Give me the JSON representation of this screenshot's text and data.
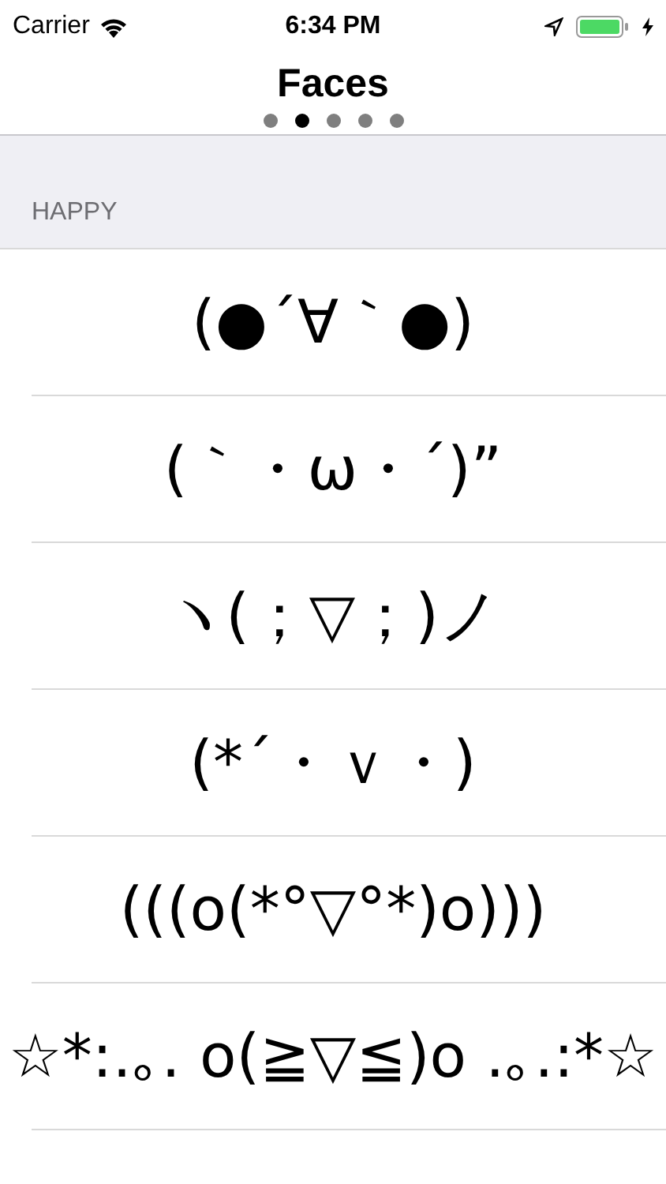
{
  "status_bar": {
    "carrier": "Carrier",
    "time": "6:34 PM"
  },
  "nav": {
    "title": "Faces",
    "pages": [
      {
        "selected": false
      },
      {
        "selected": true
      },
      {
        "selected": false
      },
      {
        "selected": false
      },
      {
        "selected": false
      }
    ]
  },
  "section": {
    "header": "HAPPY",
    "rows": [
      {
        "face": "(●´∀｀●)"
      },
      {
        "face": "(｀・ω・´)”"
      },
      {
        "face": "ヽ(；▽；)ノ"
      },
      {
        "face": "(*´・ｖ・)"
      },
      {
        "face": "(((o(*°▽°*)o)))"
      },
      {
        "face": "☆*:.｡. o(≧▽≦)o .｡.:*☆"
      }
    ]
  }
}
